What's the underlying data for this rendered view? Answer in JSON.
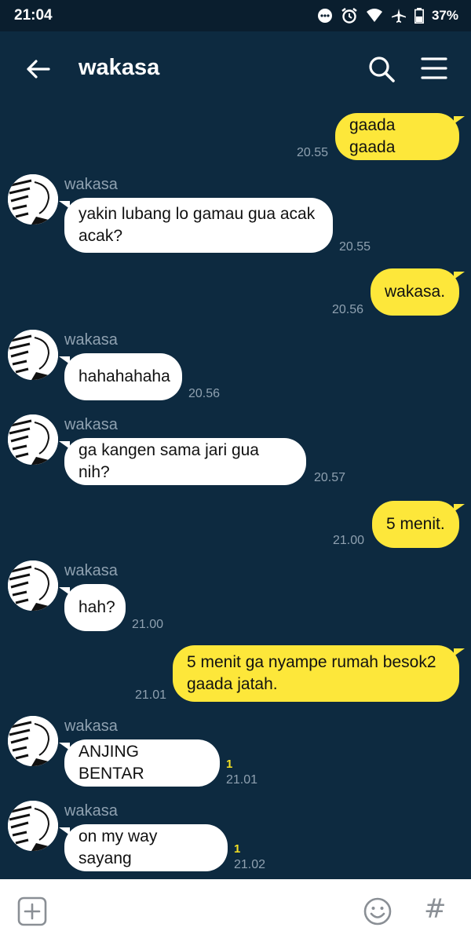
{
  "status_bar": {
    "time": "21:04",
    "battery": "37%",
    "icons": [
      "more-icon",
      "alarm-icon",
      "wifi-icon",
      "airplane-icon",
      "battery-icon"
    ]
  },
  "header": {
    "title": "wakasa",
    "icons": [
      "back-arrow-icon",
      "search-icon",
      "menu-icon"
    ]
  },
  "messages": [
    {
      "dir": "out",
      "text": "gaada gaada",
      "time": "20.55"
    },
    {
      "dir": "in",
      "sender": "wakasa",
      "text": "yakin lubang lo gamau gua acak acak?",
      "time": "20.55"
    },
    {
      "dir": "out",
      "text": "wakasa.",
      "time": "20.56"
    },
    {
      "dir": "in",
      "sender": "wakasa",
      "text": "hahahahaha",
      "time": "20.56"
    },
    {
      "dir": "in",
      "sender": "wakasa",
      "text": "ga kangen sama jari gua nih?",
      "time": "20.57"
    },
    {
      "dir": "out",
      "text": "5 menit.",
      "time": "21.00"
    },
    {
      "dir": "in",
      "sender": "wakasa",
      "text": "hah?",
      "time": "21.00"
    },
    {
      "dir": "out",
      "text": "5 menit ga nyampe rumah besok2 gaada jatah.",
      "time": "21.01"
    },
    {
      "dir": "in",
      "sender": "wakasa",
      "text": "ANJING BENTAR",
      "time": "21.01",
      "read": "1"
    },
    {
      "dir": "in",
      "sender": "wakasa",
      "text": "on my way sayang",
      "time": "21.02",
      "read": "1"
    }
  ],
  "bottom_bar": {
    "icons": [
      "plus-icon",
      "emoji-icon",
      "hashtag-icon"
    ],
    "hash_glyph": "#"
  },
  "colors": {
    "background": "#0d2a40",
    "incoming": "#ffffff",
    "outgoing": "#fde73a",
    "timestamp": "#8fa1b0",
    "read": "#f4e023"
  }
}
